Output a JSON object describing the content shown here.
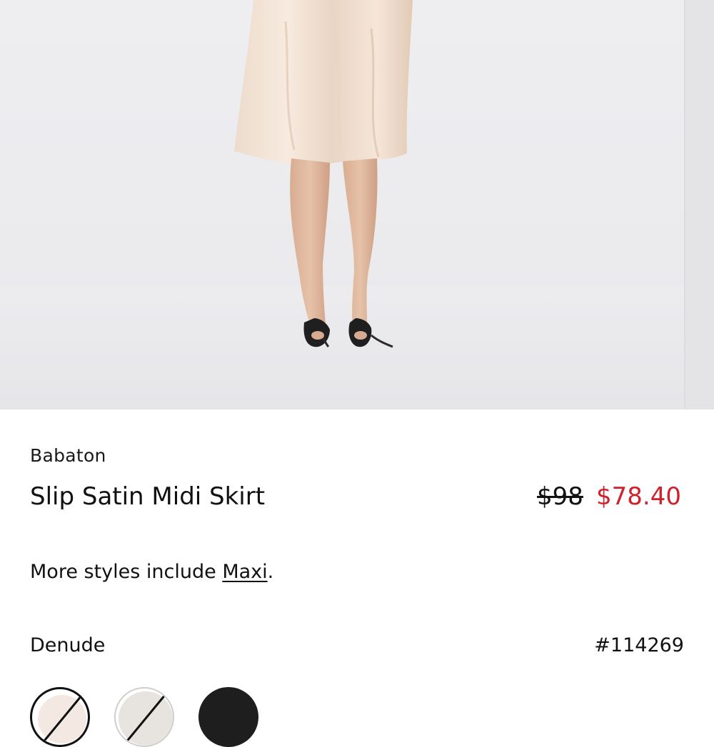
{
  "product": {
    "brand": "Babaton",
    "title": "Slip Satin Midi Skirt",
    "price_original": "$98",
    "price_sale": "$78.40",
    "sale_color": "#d0202a",
    "more_styles_prefix": "More styles include ",
    "more_styles_link": "Maxi",
    "more_styles_suffix": ".",
    "color_name": "Denude",
    "sku": "#114269"
  },
  "swatches": [
    {
      "name": "Denude",
      "color": "#f3e8e2",
      "selected": true,
      "unavailable": true
    },
    {
      "name": "light grey",
      "color": "#e7e4df",
      "selected": false,
      "unavailable": true
    },
    {
      "name": "black",
      "color": "#1e1e1e",
      "selected": false,
      "unavailable": false
    }
  ]
}
